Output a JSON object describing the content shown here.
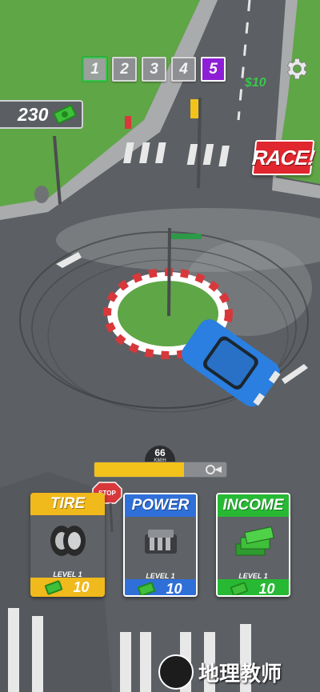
{
  "levels": {
    "items": [
      "1",
      "2",
      "3",
      "4",
      "5"
    ],
    "current": "1",
    "active": "5"
  },
  "money": {
    "amount": "230"
  },
  "race_button": {
    "label": "RACE!"
  },
  "speed": {
    "value": "66",
    "unit": "KM/H",
    "progress": 0.68
  },
  "upgrades": [
    {
      "title": "TIRE",
      "level": "LEVEL 1",
      "cost": "10",
      "color": "#f0b91c"
    },
    {
      "title": "POWER",
      "level": "LEVEL 1",
      "cost": "10",
      "color": "#2f6fd8"
    },
    {
      "title": "INCOME",
      "level": "LEVEL 1",
      "cost": "10",
      "color": "#27b934"
    }
  ],
  "scene": {
    "floating_money": "$10",
    "stop_sign": "STOP"
  },
  "watermark": {
    "text": "地理教师"
  },
  "colors": {
    "road": "#5c5f63",
    "grass": "#5fa646",
    "car": "#2a7fe0",
    "race": "#e0262e",
    "active_level": "#8e1ed6",
    "speed_fill": "#f3c31b"
  }
}
